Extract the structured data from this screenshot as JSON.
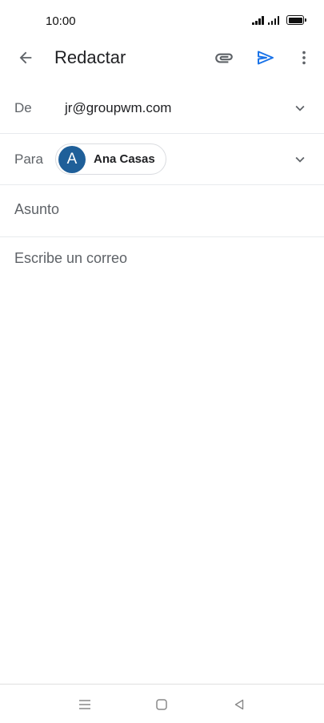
{
  "status_bar": {
    "time": "10:00",
    "icons": [
      "signal-icon",
      "signal-icon",
      "battery-icon"
    ]
  },
  "app_bar": {
    "title": "Redactar",
    "icons": {
      "back": "arrow-back-icon",
      "attach": "paperclip-icon",
      "send": "send-icon",
      "more": "more-vert-icon"
    }
  },
  "compose": {
    "from": {
      "label": "De",
      "value": "jr@groupwm.com"
    },
    "to": {
      "label": "Para",
      "recipient": {
        "initial": "A",
        "name": "Ana Casas",
        "avatar_color": "#1f5f99"
      }
    },
    "subject": {
      "placeholder": "Asunto",
      "value": ""
    },
    "body": {
      "placeholder": "Escribe un correo",
      "value": ""
    }
  },
  "colors": {
    "accent": "#1a73e8",
    "icon": "#5f6368"
  },
  "nav_bar": {
    "icons": [
      "menu-icon",
      "home-square-icon",
      "back-triangle-icon"
    ]
  }
}
